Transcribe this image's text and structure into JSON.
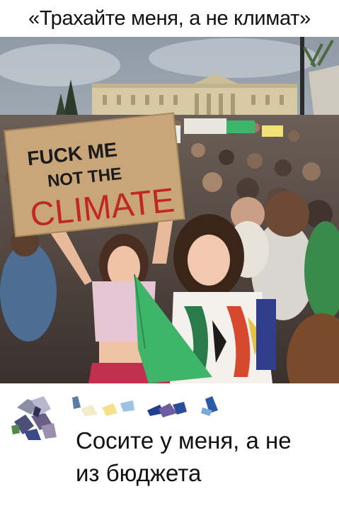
{
  "caption_top": "«Трахайте меня, а не климат»",
  "photo": {
    "sign_text": [
      "FUCK ME",
      "NOT THE",
      "CLIMATE"
    ],
    "sign_color": "#c9a679",
    "sign_ink_black": "#1a1a1a",
    "sign_ink_red": "#c0271f",
    "flag_color": "#3fb56a",
    "sky_color": "#aeb9c4"
  },
  "comment": {
    "author_name": "",
    "text_lines": [
      "Сосите у меня, а не",
      "из бюджета"
    ]
  }
}
